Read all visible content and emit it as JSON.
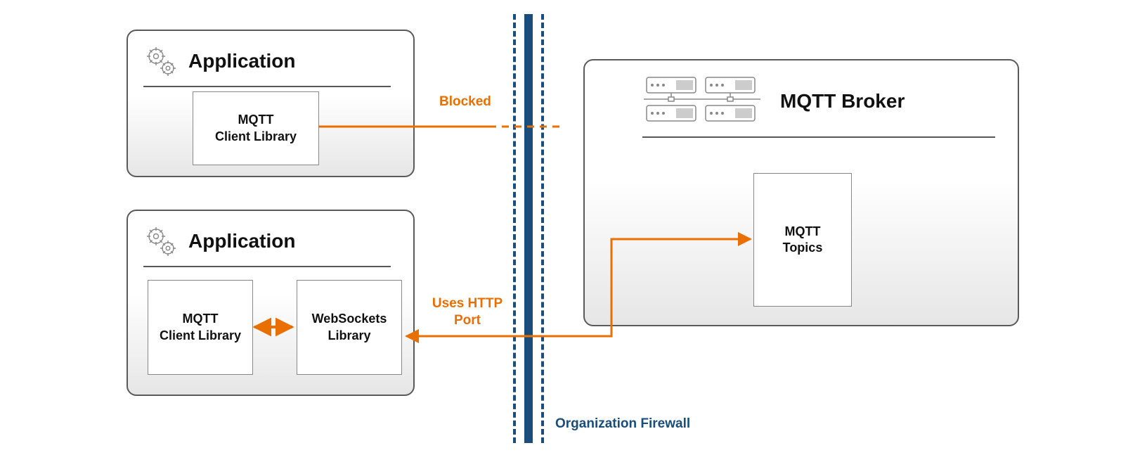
{
  "panels": {
    "app1": {
      "title": "Application",
      "mqtt_lib": "MQTT\nClient Library"
    },
    "app2": {
      "title": "Application",
      "mqtt_lib": "MQTT\nClient Library",
      "ws_lib": "WebSockets\nLibrary"
    },
    "broker": {
      "title": "MQTT Broker",
      "topics": "MQTT\nTopics"
    }
  },
  "labels": {
    "blocked": "Blocked",
    "uses_http": "Uses HTTP\nPort",
    "firewall": "Organization Firewall"
  },
  "colors": {
    "accent": "#e86f00",
    "firewall": "#1a4d7a"
  }
}
